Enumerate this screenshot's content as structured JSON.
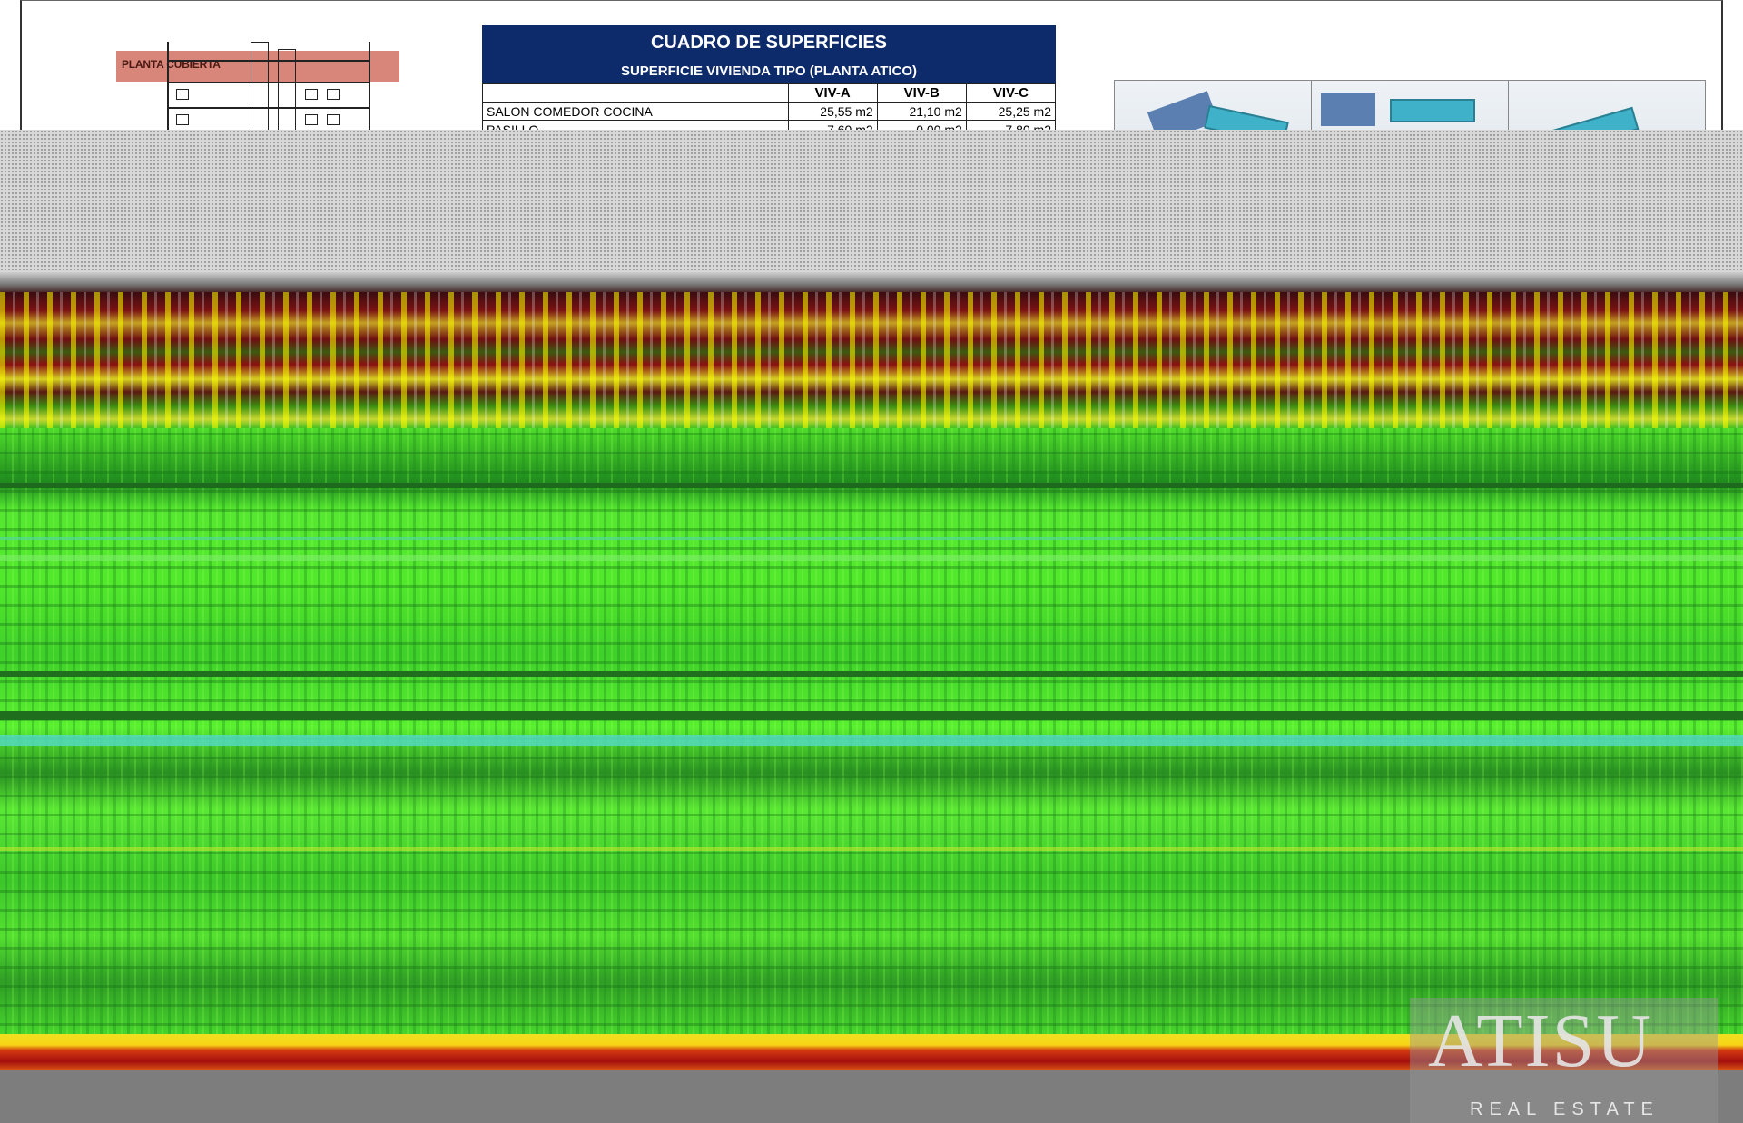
{
  "section": {
    "roof_label": "PLANTA CUBIERTA"
  },
  "table": {
    "title": "CUADRO DE SUPERFICIES",
    "subtitle": "SUPERFICIE VIVIENDA TIPO  (PLANTA ATICO)",
    "columns": [
      "",
      "VIV-A",
      "VIV-B",
      "VIV-C"
    ],
    "rows": [
      {
        "label": "SALON COMEDOR COCINA",
        "a": "25,55 m2",
        "b": "21,10 m2",
        "c": "25,25 m2"
      },
      {
        "label": "PASILLO",
        "a": "7,60 m2",
        "b": "0,00 m2",
        "c": "7,80 m2"
      }
    ]
  },
  "watermark": {
    "logo": "ATISU",
    "tagline": "REAL ESTATE"
  },
  "colors": {
    "header_blue": "#0d2a6b",
    "roof_band": "#d9867a",
    "glitch_green": "#4fdc2a"
  }
}
